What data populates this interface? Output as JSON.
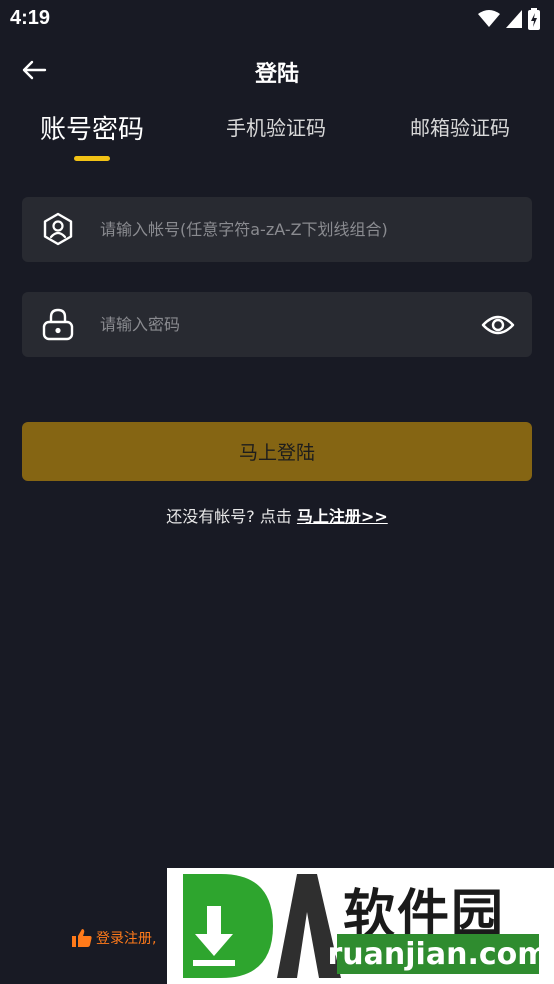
{
  "status_bar": {
    "time": "4:19"
  },
  "header": {
    "title": "登陆"
  },
  "tabs": [
    {
      "label": "账号密码",
      "active": true
    },
    {
      "label": "手机验证码",
      "active": false
    },
    {
      "label": "邮箱验证码",
      "active": false
    }
  ],
  "account_field": {
    "placeholder": "请输入帐号(任意字符a-zA-Z下划线组合)",
    "icon": "user-badge-icon"
  },
  "password_field": {
    "placeholder": "请输入密码",
    "icon": "lock-icon",
    "toggle_icon": "eye-icon"
  },
  "login_button": {
    "label": "马上登陆"
  },
  "register": {
    "prompt": "还没有帐号? 点击 ",
    "link": "马上注册>>"
  },
  "footer_note": {
    "text": "登录注册,",
    "icon": "thumbs-up-icon"
  },
  "watermark": {
    "cn": "软件园",
    "en": "ruanjian.com"
  },
  "colors": {
    "background": "#181a24",
    "field": "#282a31",
    "accent": "#f2c215",
    "button": "#856513"
  }
}
